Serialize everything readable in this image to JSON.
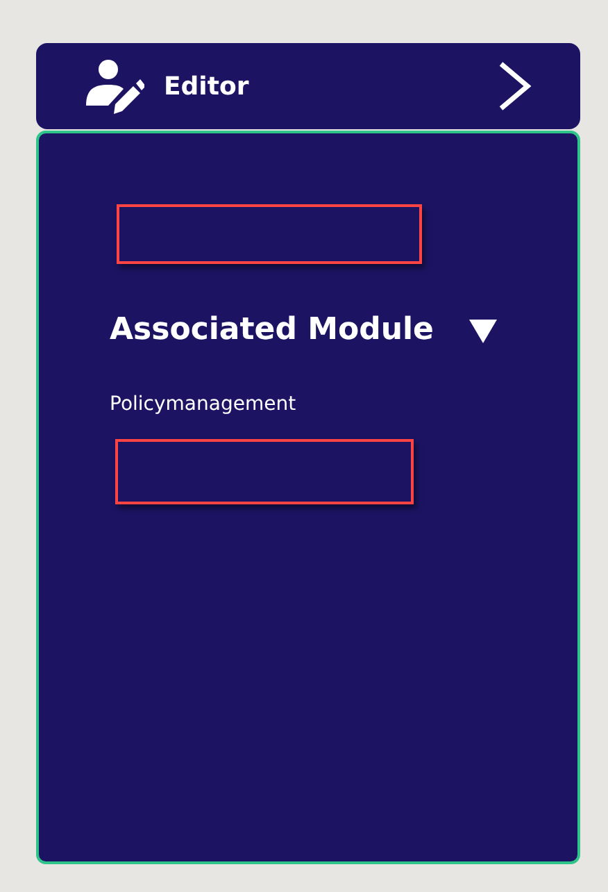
{
  "header": {
    "title": "Editor"
  },
  "panel": {
    "items": [
      {
        "kind": "box"
      },
      {
        "kind": "heading",
        "text": "Associated Module",
        "expanded": true
      },
      {
        "kind": "label",
        "text": "Policymanagement"
      },
      {
        "kind": "box"
      }
    ]
  }
}
